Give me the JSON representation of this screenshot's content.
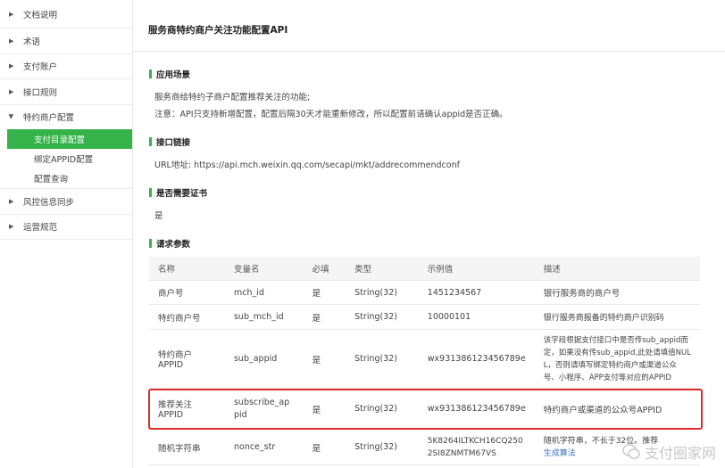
{
  "sidebar": {
    "items": [
      {
        "label": "文档说明",
        "expanded": false
      },
      {
        "label": "术语",
        "expanded": false
      },
      {
        "label": "支付账户",
        "expanded": false
      },
      {
        "label": "接口规则",
        "expanded": false
      },
      {
        "label": "特约商户配置",
        "expanded": true
      },
      {
        "label": "风控信息同步",
        "expanded": false
      },
      {
        "label": "运营规范",
        "expanded": false
      }
    ],
    "subitems": [
      {
        "label": "支付目录配置",
        "active": true
      },
      {
        "label": "绑定APPID配置",
        "active": false
      },
      {
        "label": "配置查询",
        "active": false
      }
    ]
  },
  "page": {
    "title": "服务商特约商户关注功能配置API",
    "sections": {
      "scene": {
        "heading": "应用场景",
        "line1": "服务商给特约子商户配置推荐关注的功能;",
        "line2": "注意：API只支持新增配置，配置后隔30天才能重新修改，所以配置前请确认appid是否正确。"
      },
      "link": {
        "heading": "接口链接",
        "text": "URL地址: https://api.mch.weixin.qq.com/secapi/mkt/addrecommendconf"
      },
      "cert": {
        "heading": "是否需要证书",
        "text": "是"
      },
      "params": {
        "heading": "请求参数"
      }
    }
  },
  "table": {
    "headers": [
      "名称",
      "变量名",
      "必填",
      "类型",
      "示例值",
      "描述"
    ],
    "rows": [
      {
        "name": "商户号",
        "var": "mch_id",
        "req": "是",
        "type": "String(32)",
        "example": "1451234567",
        "desc": "银行服务商的商户号"
      },
      {
        "name": "特约商户号",
        "var": "sub_mch_id",
        "req": "是",
        "type": "String(32)",
        "example": "10000101",
        "desc": "银行服务商报备的特约商户识别码"
      },
      {
        "name": "特约商户APPID",
        "var": "sub_appid",
        "req": "是",
        "type": "String(32)",
        "example": "wx931386123456789e",
        "desc": "该字段根据支付接口中是否传sub_appid而定，如果没有传sub_appid,此处请填值NULL，否则请填写绑定特约商户或渠道公众号、小程序、APP支付等对应的APPID"
      },
      {
        "name": "推荐关注APPID",
        "var": "subscribe_appid",
        "req": "是",
        "type": "String(32)",
        "example": "wx931386123456789e",
        "desc": "特约商户或渠道的公众号APPID"
      },
      {
        "name": "随机字符串",
        "var": "nonce_str",
        "req": "是",
        "type": "String(32)",
        "example": "5K8264ILTKCH16CQ2502SI8ZNMTM67VS",
        "desc": "随机字符串，不长于32位。推荐",
        "desc_link": "生成算法"
      }
    ]
  },
  "watermark": {
    "text": "支付圈家网"
  },
  "colors": {
    "accent": "#35b34a",
    "highlight": "#e02b2b",
    "link": "#3a6fc2"
  }
}
